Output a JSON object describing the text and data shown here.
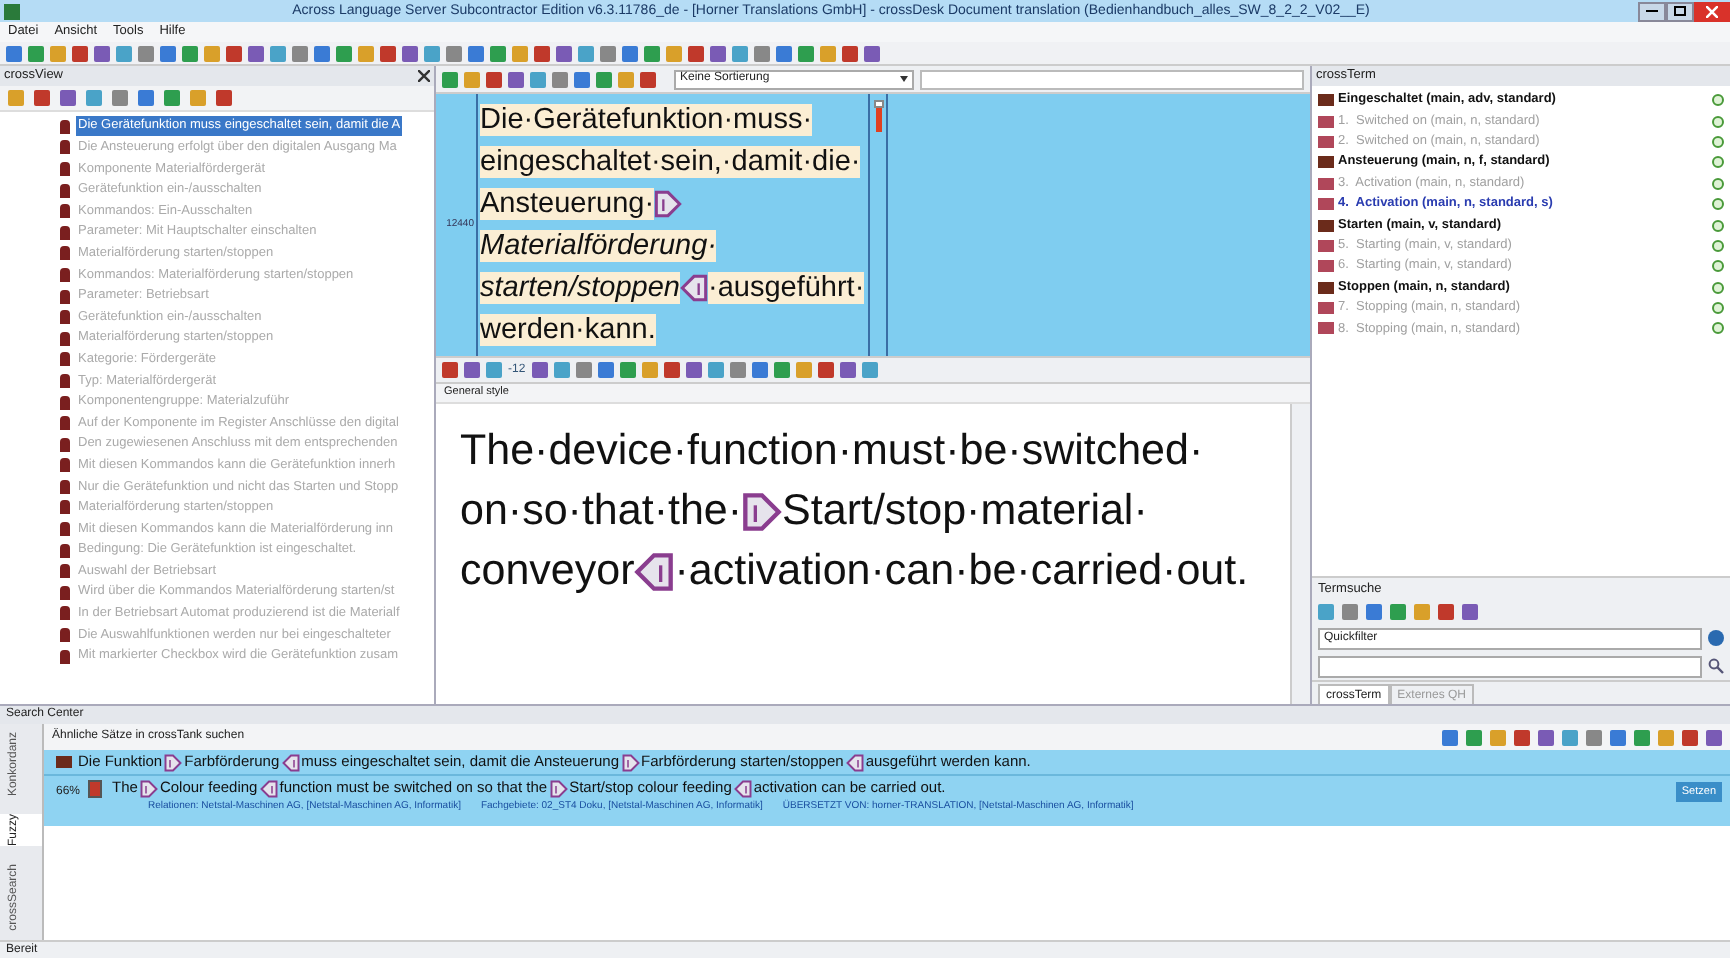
{
  "window": {
    "title": "Across Language Server Subcontractor Edition v6.3.11786_de - [Horner Translations GmbH] - crossDesk Document translation (Bedienhandbuch_alles_SW_8_2_2_V02__E)"
  },
  "menu": [
    "Datei",
    "Ansicht",
    "Tools",
    "Hilfe"
  ],
  "cross_view": {
    "title": "crossView",
    "items": [
      {
        "text": "Die Gerätefunktion muss eingeschaltet sein, damit die A",
        "selected": true
      },
      {
        "text": "Die Ansteuerung erfolgt über den digitalen Ausgang Ma",
        "selected": false
      },
      {
        "text": "Komponente Materialfördergerät",
        "selected": false
      },
      {
        "text": "Gerätefunktion ein-/ausschalten",
        "selected": false
      },
      {
        "text": "Kommandos: Ein-Ausschalten",
        "selected": false
      },
      {
        "text": "Parameter: Mit Hauptschalter einschalten",
        "selected": false
      },
      {
        "text": "Materialförderung starten/stoppen",
        "selected": false
      },
      {
        "text": "Kommandos: Materialförderung starten/stoppen",
        "selected": false
      },
      {
        "text": "Parameter: Betriebsart",
        "selected": false
      },
      {
        "text": "Gerätefunktion ein-/ausschalten",
        "selected": false
      },
      {
        "text": "Materialförderung starten/stoppen",
        "selected": false
      },
      {
        "text": "Kategorie: Fördergeräte",
        "selected": false
      },
      {
        "text": "Typ: Materialfördergerät",
        "selected": false
      },
      {
        "text": "Komponentengruppe: Materialzuführ",
        "selected": false
      },
      {
        "text": "Auf der Komponente im Register Anschlüsse den digital",
        "selected": false
      },
      {
        "text": "Den zugewiesenen Anschluss mit dem entsprechenden",
        "selected": false
      },
      {
        "text": "Mit diesen Kommandos kann die Gerätefunktion innerh",
        "selected": false
      },
      {
        "text": "Nur die Gerätefunktion und nicht das Starten und Stopp",
        "selected": false
      },
      {
        "text": "Materialförderung starten/stoppen",
        "selected": false
      },
      {
        "text": "Mit diesen Kommandos kann die Materialförderung inn",
        "selected": false
      },
      {
        "text": "Bedingung: Die Gerätefunktion ist eingeschaltet.",
        "selected": false
      },
      {
        "text": "Auswahl der Betriebsart",
        "selected": false
      },
      {
        "text": "Wird über die Kommandos Materialförderung starten/st",
        "selected": false
      },
      {
        "text": "In der Betriebsart Automat produzierend ist die Materialf",
        "selected": false
      },
      {
        "text": "Die Auswahlfunktionen werden nur bei eingeschalteter",
        "selected": false
      },
      {
        "text": "Mit markierter Checkbox wird die Gerätefunktion zusam",
        "selected": false
      }
    ]
  },
  "editor": {
    "sort": "Keine Sortierung",
    "font_size": "-12",
    "style": "General style",
    "segment_number": "12440",
    "source": [
      {
        "kind": "text",
        "text": "Die·Gerätefunktion·muss·eingeschaltet·sein,·damit·die·Ansteuerung·",
        "italic": false
      },
      {
        "kind": "tag_open"
      },
      {
        "kind": "text",
        "text": "Materialförderung·starten/stoppen",
        "italic": true
      },
      {
        "kind": "tag_close"
      },
      {
        "kind": "text",
        "text": "·ausgeführt·werden·kann.",
        "italic": false
      }
    ],
    "target": [
      {
        "kind": "text",
        "text": "The·device·function·must·be·switched·on·so·that·the·"
      },
      {
        "kind": "tag_open"
      },
      {
        "kind": "text",
        "text": "Start/stop·material·conveyor"
      },
      {
        "kind": "tag_close"
      },
      {
        "kind": "text",
        "text": "·activation·can·be·carried·out."
      }
    ]
  },
  "cross_term": {
    "title": "crossTerm",
    "terms": [
      {
        "kind": "source",
        "text": "Eingeschaltet (main, adv, standard)",
        "selected": false
      },
      {
        "kind": "target",
        "text": "1.  Switched on (main, n, standard)",
        "selected": false
      },
      {
        "kind": "target",
        "text": "2.  Switched on (main, n, standard)",
        "selected": false
      },
      {
        "kind": "source",
        "text": "Ansteuerung (main, n, f, standard)",
        "selected": false
      },
      {
        "kind": "target",
        "text": "3.  Activation (main, n, standard)",
        "selected": false
      },
      {
        "kind": "target",
        "text": "4.  Activation (main, n, standard, s)",
        "selected": true
      },
      {
        "kind": "source",
        "text": "Starten (main, v, standard)",
        "selected": false
      },
      {
        "kind": "target",
        "text": "5.  Starting (main, v, standard)",
        "selected": false
      },
      {
        "kind": "target",
        "text": "6.  Starting (main, v, standard)",
        "selected": false
      },
      {
        "kind": "source",
        "text": "Stoppen (main, n, standard)",
        "selected": false
      },
      {
        "kind": "target",
        "text": "7.  Stopping (main, n, standard)",
        "selected": false
      },
      {
        "kind": "target",
        "text": "8.  Stopping (main, n, standard)",
        "selected": false
      }
    ],
    "search_title": "Termsuche",
    "filter": "Quickfilter",
    "tabs": [
      {
        "label": "crossTerm",
        "selected": true
      },
      {
        "label": "Externes QH",
        "selected": false
      }
    ]
  },
  "search_center": {
    "title": "Search Center",
    "subtitle": "Ähnliche Sätze in crossTank suchen",
    "side_tabs": [
      {
        "label": "Konkordanz",
        "selected": false
      },
      {
        "label": "Fuzzy",
        "selected": true
      },
      {
        "label": "crossSearch",
        "selected": false
      }
    ],
    "source": [
      {
        "kind": "text",
        "text": "Die Funktion "
      },
      {
        "kind": "tag_open"
      },
      {
        "kind": "text",
        "text": "Farbförderung"
      },
      {
        "kind": "tag_close"
      },
      {
        "kind": "text",
        "text": " muss eingeschaltet sein, damit die Ansteuerung "
      },
      {
        "kind": "tag_open"
      },
      {
        "kind": "text",
        "text": "Farbförderung starten/stoppen"
      },
      {
        "kind": "tag_close"
      },
      {
        "kind": "text",
        "text": " ausgeführt werden kann."
      }
    ],
    "match": "66%",
    "target": [
      {
        "kind": "text",
        "text": "The "
      },
      {
        "kind": "tag_open"
      },
      {
        "kind": "text",
        "text": "Colour feeding"
      },
      {
        "kind": "tag_close"
      },
      {
        "kind": "text",
        "text": " function must be switched on so that the "
      },
      {
        "kind": "tag_open"
      },
      {
        "kind": "text",
        "text": "Start/stop colour feeding"
      },
      {
        "kind": "tag_close"
      },
      {
        "kind": "text",
        "text": " activation can be carried out."
      }
    ],
    "meta": [
      "Relationen: Netstal-Maschinen AG, [Netstal-Maschinen AG, Informatik]",
      "Fachgebiete: 02_ST4 Doku, [Netstal-Maschinen AG, Informatik]",
      "ÜBERSETZT VON: horner-TRANSLATION, [Netstal-Maschinen AG, Informatik]"
    ],
    "apply_button": "Setzen"
  },
  "status_bar": "Bereit"
}
